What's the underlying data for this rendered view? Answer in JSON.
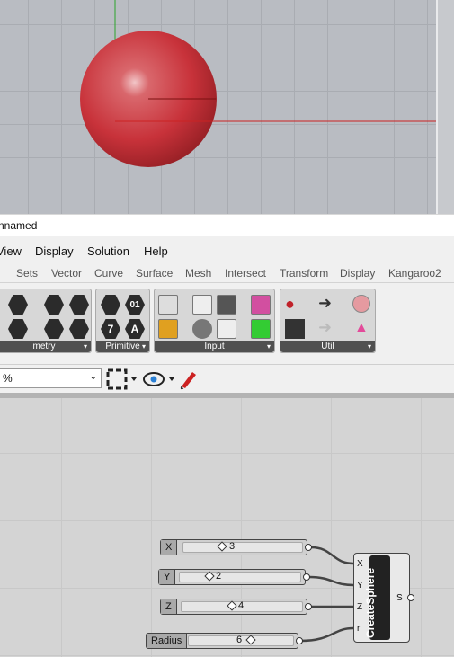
{
  "window": {
    "title": "nnamed"
  },
  "menu": [
    {
      "label": "View"
    },
    {
      "label": "Display"
    },
    {
      "label": "Solution"
    },
    {
      "label": "Help"
    }
  ],
  "tabs": [
    "Sets",
    "Vector",
    "Curve",
    "Surface",
    "Mesh",
    "Intersect",
    "Transform",
    "Display",
    "Kangaroo2"
  ],
  "ribbon": {
    "panels": [
      {
        "label": "metry"
      },
      {
        "label": "Primitive"
      },
      {
        "label": "Input"
      },
      {
        "label": "Util"
      }
    ],
    "primitive_icons": [
      "01",
      "7",
      "A"
    ]
  },
  "toolbar": {
    "zoom": "%"
  },
  "canvas": {
    "sliders": [
      {
        "name": "X",
        "value": "3"
      },
      {
        "name": "Y",
        "value": "2"
      },
      {
        "name": "Z",
        "value": "4"
      },
      {
        "name": "Radius",
        "value": "6"
      }
    ],
    "component": {
      "name": "CreateSphere",
      "inputs": [
        "X",
        "Y",
        "Z",
        "r"
      ],
      "output": "S"
    }
  },
  "colors": {
    "sphere": "#c8323a",
    "viewport_bg": "#b9bcc2",
    "canvas_bg": "#d4d4d4"
  }
}
